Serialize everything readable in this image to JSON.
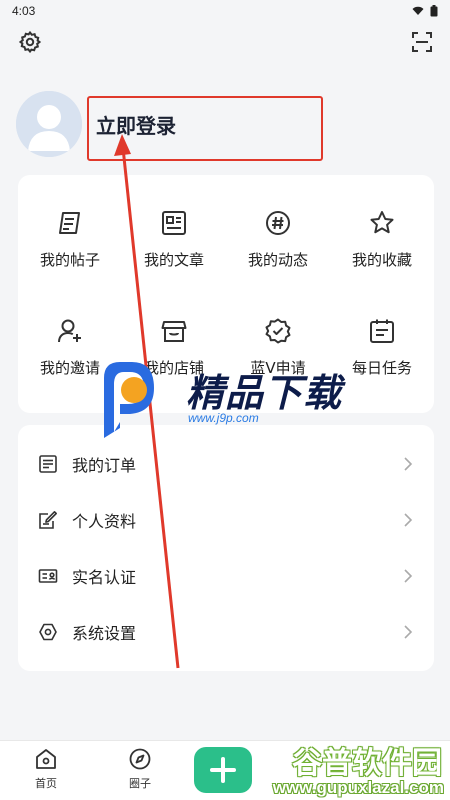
{
  "status_bar": {
    "time": "4:03"
  },
  "profile": {
    "login_label": "立即登录"
  },
  "grid": {
    "items": [
      {
        "label": "我的帖子",
        "icon": "post-icon"
      },
      {
        "label": "我的文章",
        "icon": "article-icon"
      },
      {
        "label": "我的动态",
        "icon": "hashtag-icon"
      },
      {
        "label": "我的收藏",
        "icon": "star-icon"
      },
      {
        "label": "我的邀请",
        "icon": "invite-icon"
      },
      {
        "label": "我的店铺",
        "icon": "store-icon"
      },
      {
        "label": "蓝V申请",
        "icon": "badge-check-icon"
      },
      {
        "label": "每日任务",
        "icon": "calendar-task-icon"
      }
    ]
  },
  "list": {
    "items": [
      {
        "label": "我的订单",
        "icon": "order-icon"
      },
      {
        "label": "个人资料",
        "icon": "edit-profile-icon"
      },
      {
        "label": "实名认证",
        "icon": "id-card-icon"
      },
      {
        "label": "系统设置",
        "icon": "settings-hex-icon"
      }
    ]
  },
  "bottom_nav": {
    "home_label": "首页",
    "circle_label": "圈子"
  },
  "watermarks": {
    "primary_title": "精品下载",
    "primary_url": "www.j9p.com",
    "secondary_title": "谷普软件园",
    "secondary_url": "www.gupuxlazal.com"
  },
  "colors": {
    "accent_green": "#2bbf8a",
    "annotation_red": "#e0392b",
    "background": "#f4f5f7"
  }
}
